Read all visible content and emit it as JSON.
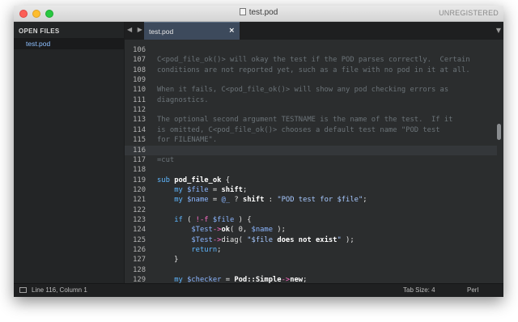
{
  "window": {
    "title": "test.pod",
    "unregistered": "UNREGISTERED"
  },
  "sidebar": {
    "header": "OPEN FILES",
    "items": [
      {
        "label": "test.pod"
      }
    ]
  },
  "tabs": [
    {
      "label": "test.pod",
      "close": "×"
    }
  ],
  "nav": {
    "arrows": "◀ ▶",
    "menu": "▼"
  },
  "editor": {
    "lines": [
      {
        "n": "106",
        "segs": []
      },
      {
        "n": "107",
        "segs": [
          {
            "c": "cmt",
            "t": "C<pod_file_ok()> will okay the test if the POD parses correctly.  Certain"
          }
        ]
      },
      {
        "n": "108",
        "segs": [
          {
            "c": "cmt",
            "t": "conditions are not reported yet, such as a file with no pod in it at all."
          }
        ]
      },
      {
        "n": "109",
        "segs": []
      },
      {
        "n": "110",
        "segs": [
          {
            "c": "cmt",
            "t": "When it fails, C<pod_file_ok()> will show any pod checking errors as"
          }
        ]
      },
      {
        "n": "111",
        "segs": [
          {
            "c": "cmt",
            "t": "diagnostics."
          }
        ]
      },
      {
        "n": "112",
        "segs": []
      },
      {
        "n": "113",
        "segs": [
          {
            "c": "cmt",
            "t": "The optional second argument TESTNAME is the name of the test.  If it"
          }
        ]
      },
      {
        "n": "114",
        "segs": [
          {
            "c": "cmt",
            "t": "is omitted, C<pod_file_ok()> chooses a default test name \"POD test"
          }
        ]
      },
      {
        "n": "115",
        "segs": [
          {
            "c": "cmt",
            "t": "for FILENAME\"."
          }
        ]
      },
      {
        "n": "116",
        "segs": [],
        "cursor": true
      },
      {
        "n": "117",
        "segs": [
          {
            "c": "cmt",
            "t": "=cut"
          }
        ]
      },
      {
        "n": "118",
        "segs": []
      },
      {
        "n": "119",
        "segs": [
          {
            "c": "kw",
            "t": "sub "
          },
          {
            "c": "fn",
            "t": "pod_file_ok"
          },
          {
            "c": "plain",
            "t": " {"
          }
        ]
      },
      {
        "n": "120",
        "segs": [
          {
            "c": "plain",
            "t": "    "
          },
          {
            "c": "kw",
            "t": "my "
          },
          {
            "c": "var",
            "t": "$file"
          },
          {
            "c": "plain",
            "t": " = "
          },
          {
            "c": "fn",
            "t": "shift"
          },
          {
            "c": "plain",
            "t": ";"
          }
        ]
      },
      {
        "n": "121",
        "segs": [
          {
            "c": "plain",
            "t": "    "
          },
          {
            "c": "kw",
            "t": "my "
          },
          {
            "c": "var",
            "t": "$name"
          },
          {
            "c": "plain",
            "t": " = "
          },
          {
            "c": "var",
            "t": "@_"
          },
          {
            "c": "plain",
            "t": " ? "
          },
          {
            "c": "fn",
            "t": "shift"
          },
          {
            "c": "plain",
            "t": " : "
          },
          {
            "c": "str",
            "t": "\"POD test for $file\""
          },
          {
            "c": "plain",
            "t": ";"
          }
        ]
      },
      {
        "n": "122",
        "segs": []
      },
      {
        "n": "123",
        "segs": [
          {
            "c": "plain",
            "t": "    "
          },
          {
            "c": "kw",
            "t": "if"
          },
          {
            "c": "plain",
            "t": " ( "
          },
          {
            "c": "op",
            "t": "!-f"
          },
          {
            "c": "plain",
            "t": " "
          },
          {
            "c": "var",
            "t": "$file"
          },
          {
            "c": "plain",
            "t": " ) {"
          }
        ]
      },
      {
        "n": "124",
        "segs": [
          {
            "c": "plain",
            "t": "        "
          },
          {
            "c": "var",
            "t": "$Test"
          },
          {
            "c": "op",
            "t": "->"
          },
          {
            "c": "fn",
            "t": "ok"
          },
          {
            "c": "plain",
            "t": "( 0, "
          },
          {
            "c": "var",
            "t": "$name"
          },
          {
            "c": "plain",
            "t": " );"
          }
        ]
      },
      {
        "n": "125",
        "segs": [
          {
            "c": "plain",
            "t": "        "
          },
          {
            "c": "var",
            "t": "$Test"
          },
          {
            "c": "op",
            "t": "->"
          },
          {
            "c": "plain",
            "t": "diag( "
          },
          {
            "c": "str",
            "t": "\"$file "
          },
          {
            "c": "fn",
            "t": "does not exist"
          },
          {
            "c": "str",
            "t": "\""
          },
          {
            "c": "plain",
            "t": " );"
          }
        ]
      },
      {
        "n": "126",
        "segs": [
          {
            "c": "plain",
            "t": "        "
          },
          {
            "c": "kw",
            "t": "return"
          },
          {
            "c": "plain",
            "t": ";"
          }
        ]
      },
      {
        "n": "127",
        "segs": [
          {
            "c": "plain",
            "t": "    }"
          }
        ]
      },
      {
        "n": "128",
        "segs": []
      },
      {
        "n": "129",
        "segs": [
          {
            "c": "plain",
            "t": "    "
          },
          {
            "c": "kw",
            "t": "my "
          },
          {
            "c": "var",
            "t": "$checker"
          },
          {
            "c": "plain",
            "t": " = "
          },
          {
            "c": "fn",
            "t": "Pod::Simple"
          },
          {
            "c": "op",
            "t": "->"
          },
          {
            "c": "fn",
            "t": "new"
          },
          {
            "c": "plain",
            "t": ";"
          }
        ]
      }
    ]
  },
  "status": {
    "position": "Line 116, Column 1",
    "tab_size": "Tab Size: 4",
    "syntax": "Perl"
  }
}
